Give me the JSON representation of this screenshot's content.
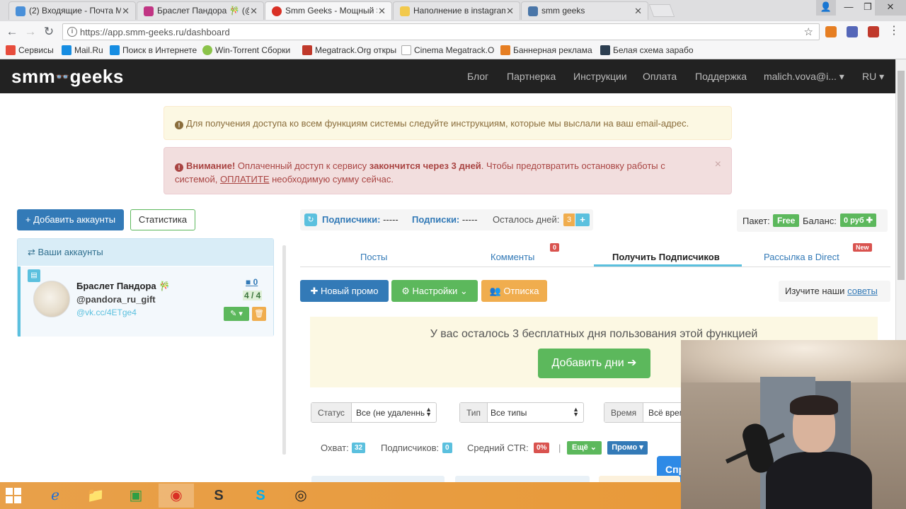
{
  "browser": {
    "tabs": [
      {
        "title": "(2) Входящие - Почта М",
        "favicon_color": "#4a90d9"
      },
      {
        "title": "Браслет Пандора 🎋 (@",
        "favicon_color": "#c13584"
      },
      {
        "title": "Smm Geeks - Мощный S",
        "favicon_color": "#d93025"
      },
      {
        "title": "Наполнение в instagram",
        "favicon_color": "#f2c94c"
      },
      {
        "title": "smm geeks",
        "favicon_color": "#4a76a8"
      }
    ],
    "tab_close": "✕",
    "window_controls": {
      "profile": "👤",
      "minimize": "—",
      "maximize": "❐",
      "close": "✕"
    },
    "url": "https://app.smm-geeks.ru/dashboard",
    "nav": {
      "back": "←",
      "forward": "→",
      "reload": "↻",
      "info": "i",
      "star": "☆"
    },
    "bookmarks": [
      {
        "label": "Сервисы",
        "icon_color": "#e74c3c"
      },
      {
        "label": "Mail.Ru",
        "icon_color": "#168de2"
      },
      {
        "label": "Поиск в Интернете",
        "icon_color": "#168de2"
      },
      {
        "label": "Win-Torrent Сборки",
        "icon_color": "#8bc34a"
      },
      {
        "label": "Megatrack.Org откры",
        "icon_color": "#c0392b"
      },
      {
        "label": "Cinema Megatrack.O",
        "icon_color": "#aaaaaa"
      },
      {
        "label": "Баннерная реклама",
        "icon_color": "#e67e22"
      },
      {
        "label": "Белая схема зарабо",
        "icon_color": "#2c3e50"
      }
    ]
  },
  "site": {
    "logo": {
      "left": "smm",
      "glasses": "👓",
      "right": "geeks"
    },
    "menu": [
      "Блог",
      "Партнерка",
      "Инструкции",
      "Оплата",
      "Поддержка",
      "malich.vova@i... ▾",
      "RU ▾"
    ]
  },
  "alerts": {
    "info_icon": "!",
    "info": "Для получения доступа ко всем функциям системы следуйте инструкциям, которые мы выслали на ваш email-адрес.",
    "danger_title": "Внимание!",
    "danger_text1": " Оплаченный доступ к сервису ",
    "danger_bold": "закончится через 3 дней",
    "danger_text2": ". Чтобы предотвратить остановку работы с системой, ",
    "danger_link": "ОПЛАТИТЕ",
    "danger_text3": " необходимую сумму сейчас.",
    "close": "×"
  },
  "left": {
    "add_button": "+ Добавить аккаунты",
    "stats_button": "Статистика",
    "panel_title": "⇄ Ваши аккаунты",
    "account": {
      "name": "Браслет Пандора 🎋",
      "username": "@pandora_ru_gift",
      "link": "@vk.cc/4ETge4",
      "comments": "0",
      "ratio": "4 / 4",
      "edit": "✎ ▾",
      "delete": "🗑",
      "doc_icon": "▤"
    }
  },
  "stats": {
    "refresh_icon": "↻",
    "subscribers_label": "Подписчики:",
    "subscribers_value": " -----",
    "subscriptions_label": "Подписки:",
    "subscriptions_value": " -----",
    "days_label": "Осталось дней:",
    "days_value": "3",
    "days_plus": "+"
  },
  "pack": {
    "label": "Пакет:",
    "plan": "Free",
    "balance_label": "Баланс:",
    "balance": "0 руб ✚"
  },
  "tabs": [
    {
      "label": "Посты"
    },
    {
      "label": "Комменты",
      "badge": "0"
    },
    {
      "label": "Получить Подписчиков"
    },
    {
      "label": "Рассылка в Direct",
      "badge": "New"
    }
  ],
  "actions": {
    "new_promo": "✚ Новый промо",
    "settings": "⚙ Настройки ⌄",
    "unsubscribe": "👥 Отписка",
    "tips_text": "Изучите наши ",
    "tips_link": "советы"
  },
  "promo": {
    "text": "У вас осталось 3 бесплатных дня пользования этой функцией",
    "button": "Добавить дни ➔"
  },
  "filters": [
    {
      "label": "Статус",
      "value": "Все (не удаленные"
    },
    {
      "label": "Тип",
      "value": "Все типы"
    },
    {
      "label": "Время",
      "value": "Всё время"
    }
  ],
  "metrics": {
    "reach_label": "Охват:",
    "reach_value": "32",
    "subs_label": "Подписчиков:",
    "subs_value": "0",
    "ctr_label": "Средний CTR:",
    "ctr_value": "0%",
    "more": "Ещё ⌄",
    "promo": "Промо ▾",
    "cut_button": "Спр"
  },
  "taskbar": {
    "items": [
      "ℯ",
      "📁",
      "▣",
      "◉",
      "S",
      "S",
      "◎"
    ]
  },
  "colors": {
    "header_bg": "#222222",
    "primary": "#337ab7",
    "success": "#5cb85c",
    "warning": "#f0ad4e",
    "info": "#5bc0de",
    "danger": "#d9534f"
  }
}
